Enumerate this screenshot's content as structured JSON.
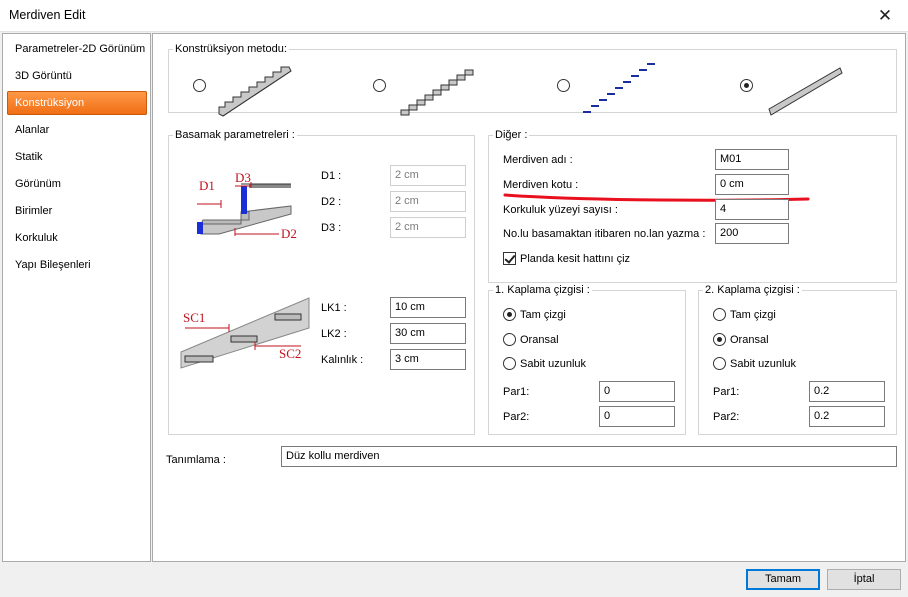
{
  "window": {
    "title": "Merdiven Edit",
    "close_glyph": "✕"
  },
  "sidebar": {
    "items": [
      {
        "label": "Parametreler-2D Görünüm"
      },
      {
        "label": "3D Görüntü"
      },
      {
        "label": "Konstrüksiyon"
      },
      {
        "label": "Alanlar"
      },
      {
        "label": "Statik"
      },
      {
        "label": "Görünüm"
      },
      {
        "label": "Birimler"
      },
      {
        "label": "Korkuluk"
      },
      {
        "label": "Yapı Bileşenleri"
      }
    ],
    "active_index": 2,
    "active_color": "#f37b22"
  },
  "construction": {
    "legend": "Konstrüksiyon metodu:",
    "options": [
      {
        "icon": "stair-solid-stepped-icon",
        "checked": false
      },
      {
        "icon": "stair-stepped-double-icon",
        "checked": false
      },
      {
        "icon": "stair-dashed-steps-icon",
        "checked": false
      },
      {
        "icon": "stair-slab-icon",
        "checked": true
      }
    ]
  },
  "step_params": {
    "legend": "Basamak parametreleri :",
    "diagram1": {
      "labels": {
        "d1": "D1",
        "d2": "D2",
        "d3": "D3"
      }
    },
    "diagram2": {
      "labels": {
        "sc1": "SC1",
        "sc2": "SC2"
      }
    },
    "d1": {
      "label": "D1 :",
      "value": "2 cm"
    },
    "d2": {
      "label": "D2 :",
      "value": "2 cm"
    },
    "d3": {
      "label": "D3 :",
      "value": "2 cm"
    },
    "lk1": {
      "label": "LK1 :",
      "value": "10 cm"
    },
    "lk2": {
      "label": "LK2 :",
      "value": "30 cm"
    },
    "kalinlik": {
      "label": "Kalınlık :",
      "value": "3 cm"
    }
  },
  "other": {
    "legend": "Diğer :",
    "name": {
      "label": "Merdiven adı :",
      "value": "M01"
    },
    "elevation": {
      "label": "Merdiven kotu :",
      "value": "0 cm"
    },
    "railing_surface": {
      "label": "Korkuluk yüzeyi sayısı :",
      "value": "4"
    },
    "numbering": {
      "label": "No.lu basamaktan itibaren no.lan yazma :",
      "value": "200"
    },
    "section_line": {
      "label": "Planda kesit hattını çiz",
      "checked": true
    },
    "annotation_color": "#e8101e"
  },
  "coating1": {
    "legend": "1. Kaplama çizgisi :",
    "options": [
      {
        "label": "Tam çizgi",
        "checked": true
      },
      {
        "label": "Oransal",
        "checked": false
      },
      {
        "label": "Sabit uzunluk",
        "checked": false
      }
    ],
    "par1": {
      "label": "Par1:",
      "value": "0"
    },
    "par2": {
      "label": "Par2:",
      "value": "0"
    }
  },
  "coating2": {
    "legend": "2. Kaplama çizgisi :",
    "options": [
      {
        "label": "Tam çizgi",
        "checked": false
      },
      {
        "label": "Oransal",
        "checked": true
      },
      {
        "label": "Sabit uzunluk",
        "checked": false
      }
    ],
    "par1": {
      "label": "Par1:",
      "value": "0.2"
    },
    "par2": {
      "label": "Par2:",
      "value": "0.2"
    }
  },
  "definition": {
    "label": "Tanımlama :",
    "value": "Düz kollu merdiven"
  },
  "buttons": {
    "ok": "Tamam",
    "cancel": "İptal"
  }
}
